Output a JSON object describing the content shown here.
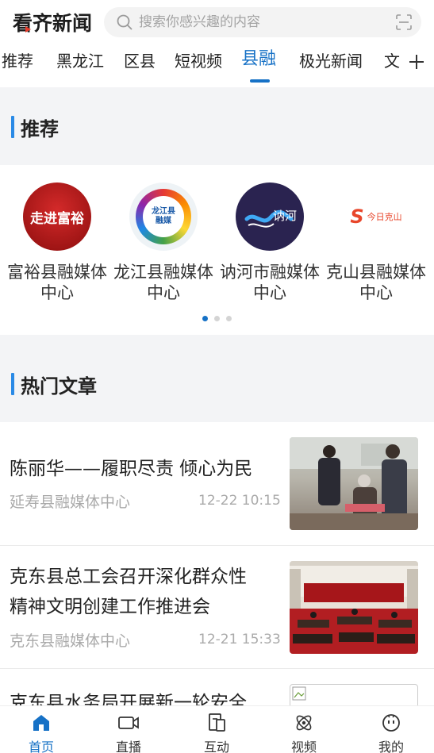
{
  "header": {
    "logo_text": "看齐新闻",
    "search_placeholder": "搜索你感兴趣的内容"
  },
  "tabs": [
    {
      "label": "推荐"
    },
    {
      "label": "黑龙江"
    },
    {
      "label": "区县"
    },
    {
      "label": "短视频"
    },
    {
      "label": "县融"
    },
    {
      "label": "极光新闻"
    },
    {
      "label": "文"
    }
  ],
  "active_tab": "县融",
  "section_recommend": {
    "title": "推荐"
  },
  "media": [
    {
      "name_line1": "富裕县融媒体",
      "name_line2": "中心",
      "logo_text": "走进富裕"
    },
    {
      "name_line1": "龙江县融媒体",
      "name_line2": "中心",
      "logo_text": "龙江县融媒"
    },
    {
      "name_line1": "讷河市融媒体",
      "name_line2": "中心",
      "logo_text": "讷河"
    },
    {
      "name_line1": "克山县融媒体",
      "name_line2": "中心",
      "logo_text": "今日克山"
    }
  ],
  "carousel": {
    "pages": 3,
    "current": 1
  },
  "section_hot": {
    "title": "热门文章"
  },
  "articles": [
    {
      "title": "陈丽华——履职尽责 倾心为民",
      "source": "延寿县融媒体中心",
      "time": "12-22 10:15"
    },
    {
      "title_line1": "克东县总工会召开深化群众性",
      "title_line2": "精神文明创建工作推进会",
      "source": "克东县融媒体中心",
      "time": "12-21 15:33"
    },
    {
      "title": "克东县水务局开展新一轮安全"
    }
  ],
  "bottom_nav": [
    {
      "label": "首页",
      "icon": "home-icon"
    },
    {
      "label": "直播",
      "icon": "live-camera-icon"
    },
    {
      "label": "互动",
      "icon": "interact-icon"
    },
    {
      "label": "视频",
      "icon": "video-icon"
    },
    {
      "label": "我的",
      "icon": "profile-icon"
    }
  ],
  "colors": {
    "accent": "#1671c6",
    "section_bar": "#2a8ae6",
    "band_bg": "#f3f4f6"
  }
}
